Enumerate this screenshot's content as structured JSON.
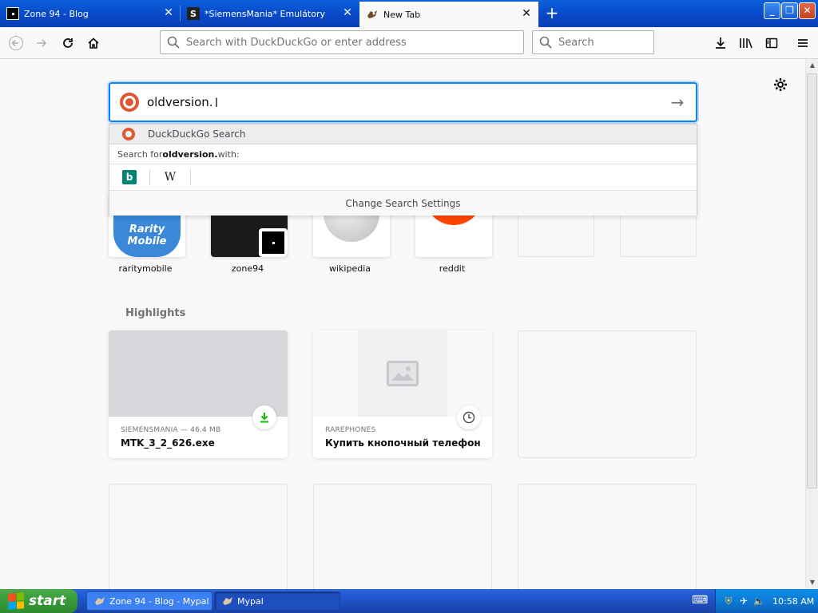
{
  "tabs": [
    {
      "title": "Zone 94 - Blog",
      "icon": "zone94-favicon",
      "active": false
    },
    {
      "title": "*SiemensMania* Emulátory",
      "icon": "siemensmania-favicon",
      "active": false
    },
    {
      "title": "New Tab",
      "icon": "mypal-favicon",
      "active": true
    }
  ],
  "toolbar": {
    "url_placeholder": "Search with DuckDuckGo or enter address",
    "search_placeholder": "Search"
  },
  "newtab": {
    "search_value": "oldversion.",
    "dropdown": {
      "suggestion": "DuckDuckGo Search",
      "search_for_prefix": "Search for ",
      "search_for_term": "oldversion.",
      "search_for_suffix": " with:",
      "engines": [
        "bing",
        "wikipedia"
      ],
      "wiki_glyph": "W",
      "bing_glyph": "b",
      "settings_label": "Change Search Settings"
    },
    "top_sites": [
      {
        "label": "raritymobile",
        "logo_text": "Rarity Mobile"
      },
      {
        "label": "zone94"
      },
      {
        "label": "wikipedia"
      },
      {
        "label": "reddit"
      },
      {
        "label": ""
      },
      {
        "label": ""
      }
    ],
    "highlights_title": "Highlights",
    "highlights": [
      {
        "meta": "SIEMENSMANIA — 46.4 MB",
        "title": "MTK_3_2_626.exe",
        "badge": "download"
      },
      {
        "meta": "RAREPHONES",
        "title": "Купить кнопочный телефон Н...",
        "badge": "history"
      }
    ]
  },
  "taskbar": {
    "start_label": "start",
    "items": [
      {
        "label": "Zone 94 - Blog - Mypal"
      },
      {
        "label": "Mypal"
      }
    ],
    "clock": "10:58 AM"
  },
  "colors": {
    "accent": "#0a84ff",
    "ddg": "#de5833",
    "reddit": "#ff4500",
    "download_green": "#12bc00"
  }
}
